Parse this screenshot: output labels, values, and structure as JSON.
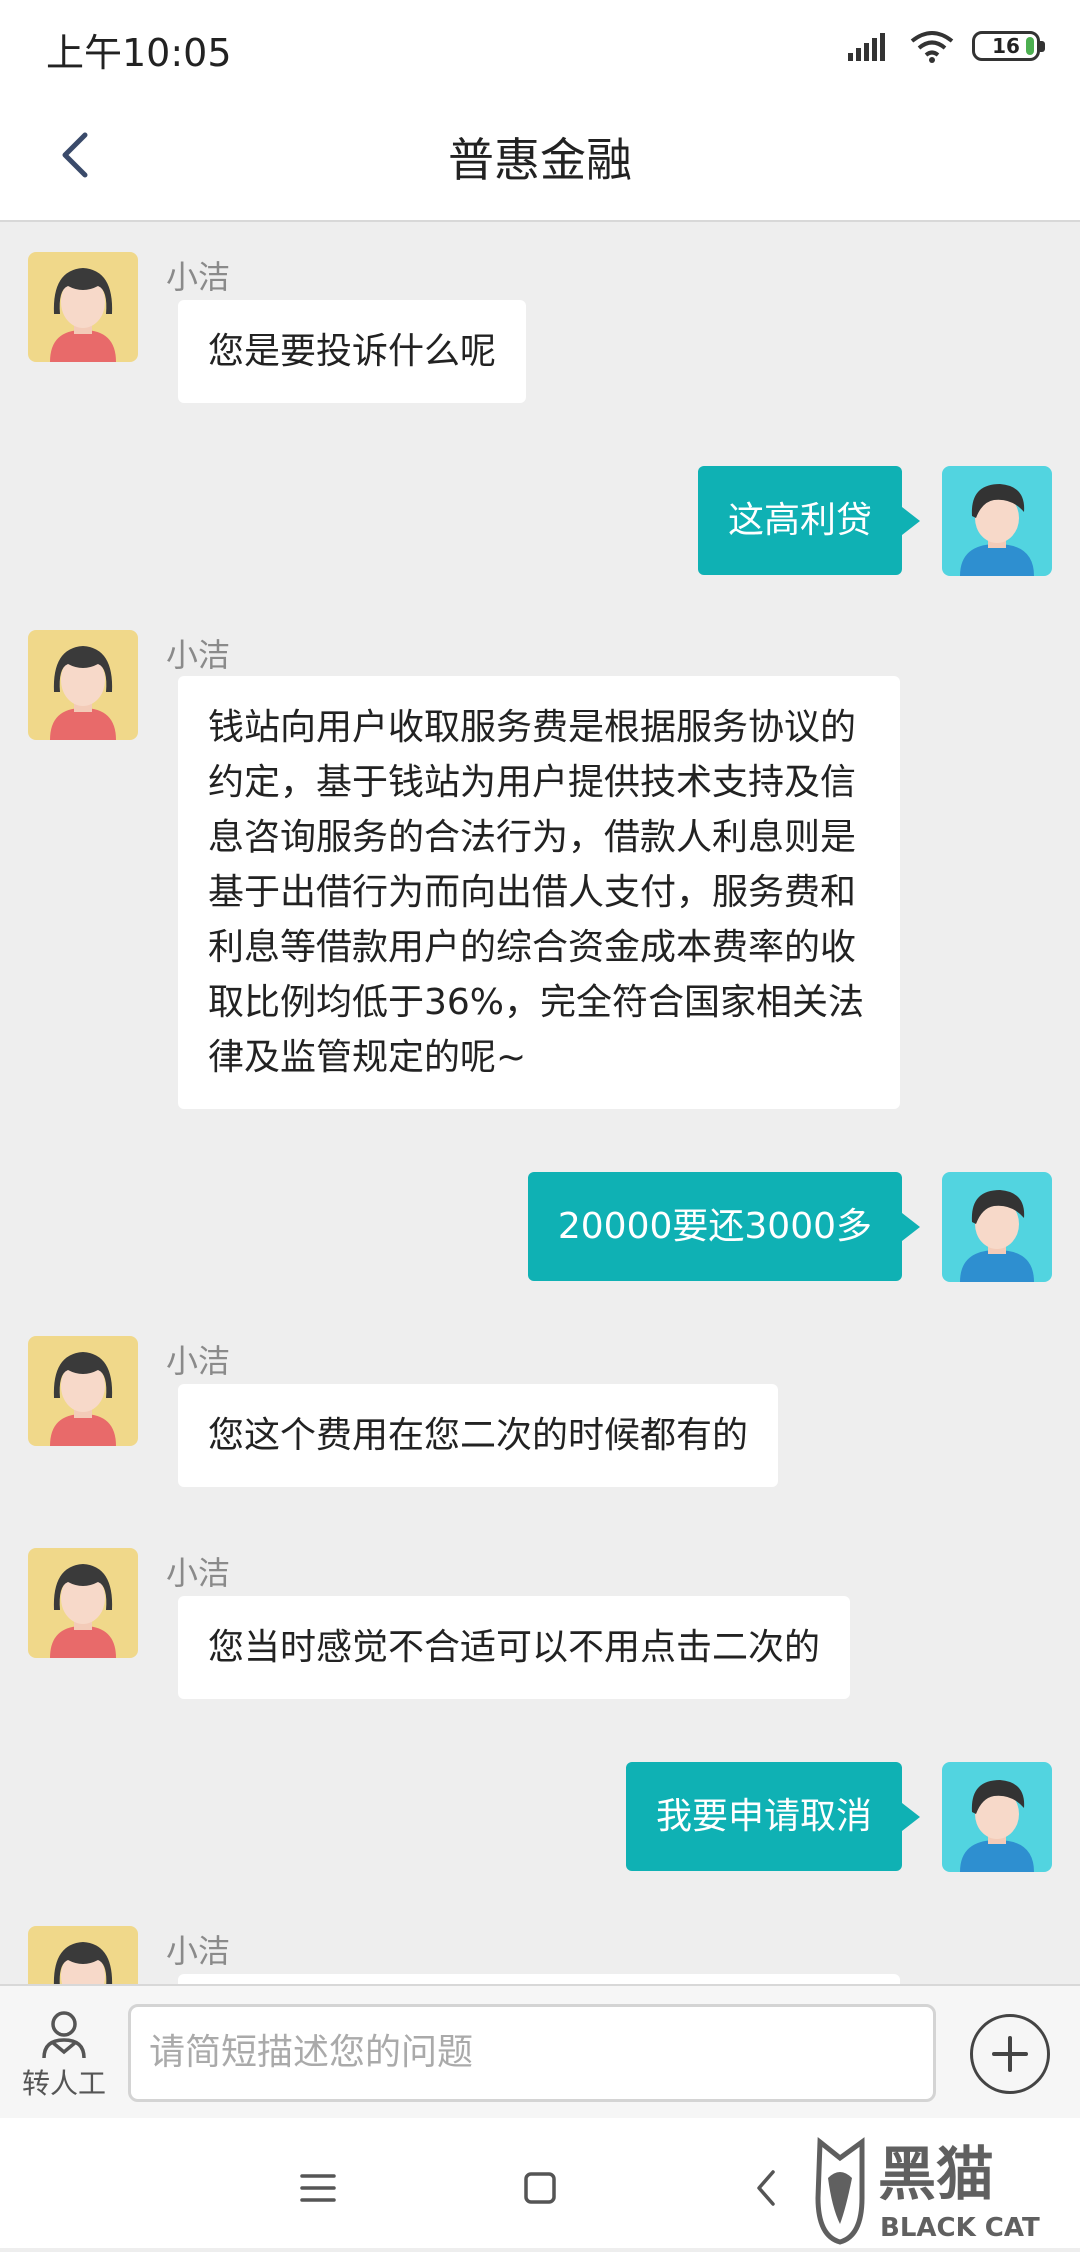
{
  "status_bar": {
    "time": "上午10:05",
    "battery": "16"
  },
  "header": {
    "title": "普惠金融"
  },
  "messages": [
    {
      "sender": "小洁",
      "text": "您是要投诉什么呢"
    },
    {
      "text": "这高利贷"
    },
    {
      "sender": "小洁",
      "text": "钱站向用户收取服务费是根据服务协议的约定，基于钱站为用户提供技术支持及信息咨询服务的合法行为，借款人利息则是基于出借行为而向出借人支付，服务费和利息等借款用户的综合资金成本费率的收取比例均低于36%，完全符合国家相关法律及监管规定的呢~"
    },
    {
      "text": "20000要还3000多"
    },
    {
      "sender": "小洁",
      "text": "您这个费用在您二次的时候都有的"
    },
    {
      "sender": "小洁",
      "text": "您当时感觉不合适可以不用点击二次的"
    },
    {
      "text": "我要申请取消"
    },
    {
      "sender": "小洁",
      "text": ""
    }
  ],
  "input_bar": {
    "human_label": "转人工",
    "placeholder": "请简短描述您的问题"
  },
  "watermark": {
    "brand_cn": "黑猫",
    "brand_en": "BLACK CAT"
  }
}
